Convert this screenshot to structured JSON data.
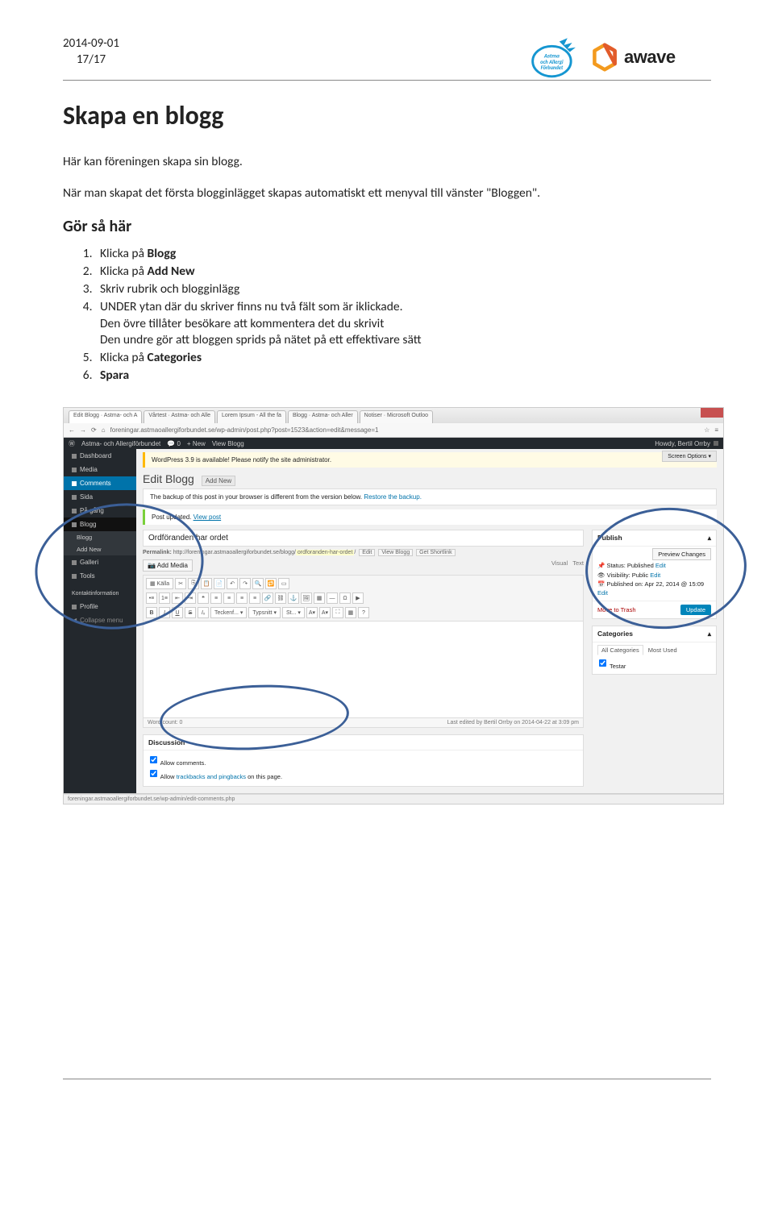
{
  "header": {
    "date": "2014-09-01",
    "page": "17/17",
    "logo_astma_lines": [
      "Astma",
      "och Allergi",
      "Förbundet"
    ],
    "logo_awave": "awave"
  },
  "title": "Skapa en blogg",
  "intro": "Här kan föreningen skapa sin blogg.",
  "intro2a": "När man skapat det första blogginlägget  skapas automatiskt ett menyval till vänster ",
  "intro2b": "\"Bloggen\".",
  "subheading": "Gör så här",
  "steps": [
    {
      "pre": "Klicka på ",
      "bold": "Blogg",
      "post": ""
    },
    {
      "pre": "Klicka på ",
      "bold": "Add New",
      "post": ""
    },
    {
      "pre": "Skriv rubrik och blogginlägg",
      "bold": "",
      "post": ""
    },
    {
      "pre": "UNDER ytan där du skriver finns nu två fält som är iklickade.",
      "bold": "",
      "post": "",
      "extra1": "Den övre tillåter besökare att kommentera det du skrivit",
      "extra2": "Den undre gör att bloggen sprids på nätet på ett effektivare sätt"
    },
    {
      "pre": "Klicka på ",
      "bold": "Categories",
      "post": ""
    },
    {
      "pre": "",
      "bold": "Spara",
      "post": ""
    }
  ],
  "browser": {
    "tabs": [
      "Edit Blogg · Astma- och A",
      "Vårtest · Astma- och Alle",
      "Lorem Ipsum - All the fa",
      "Blogg · Astma- och Aller",
      "Notiser · Microsoft Outloo"
    ],
    "url": "foreningar.astmaoallergiforbundet.se/wp-admin/post.php?post=1523&action=edit&message=1",
    "status": "foreningar.astmaoallergiforbundet.se/wp-admin/edit-comments.php"
  },
  "wp": {
    "topbar": {
      "site": "Astma- och Allergiförbundet",
      "new": "+ New",
      "view": "View Blogg",
      "howdy": "Howdy, Bertil Orrby"
    },
    "side": {
      "dashboard": "Dashboard",
      "media": "Media",
      "comments": "Comments",
      "sida": "Sida",
      "pagang": "På gång",
      "blogg": "Blogg",
      "blogg_sub": "Blogg",
      "addnew_sub": "Add New",
      "galleri": "Galleri",
      "tools": "Tools",
      "kontakt": "Kontaktinformation",
      "profile": "Profile",
      "collapse": "Collapse menu"
    },
    "screen_opts": "Screen Options ▾",
    "notice": "WordPress 3.9 is available! Please notify the site administrator.",
    "h1": "Edit Blogg",
    "h1_add": "Add New",
    "backup": "The backup of this post in your browser is different from the version below. Restore the backup.",
    "restore": "Restore the backup.",
    "updated_pre": "Post updated. ",
    "updated_link": "View post",
    "title": "Ordföranden har ordet",
    "permalink_pre": "Permalink: http://foreningar.astmaoallergiforbundet.se/blogg/",
    "permalink_slug": "ordforanden-har-ordet",
    "perm_edit": "Edit",
    "perm_view": "View Blogg",
    "perm_short": "Get Shortlink",
    "add_media": "Add Media",
    "visual": "Visual",
    "text_tab": "Text",
    "wordcount": "Word count: 0",
    "lastedit": "Last edited by Bertil Orrby on 2014-04-22 at 3:09 pm",
    "discussion_h": "Discussion",
    "allow_comments": "Allow comments.",
    "allow_trackbacks_pre": "Allow ",
    "allow_trackbacks_link": "trackbacks and pingbacks",
    "allow_trackbacks_post": " on this page.",
    "publish": {
      "h": "Publish",
      "preview": "Preview Changes",
      "status": "Status: Published",
      "visibility": "Visibility: Public",
      "published": "Published on: Apr 22, 2014 @ 15:09",
      "edit": "Edit",
      "trash": "Move to Trash",
      "update": "Update"
    },
    "categories": {
      "h": "Categories",
      "all": "All Categories",
      "most": "Most Used",
      "item": "Testar"
    }
  }
}
